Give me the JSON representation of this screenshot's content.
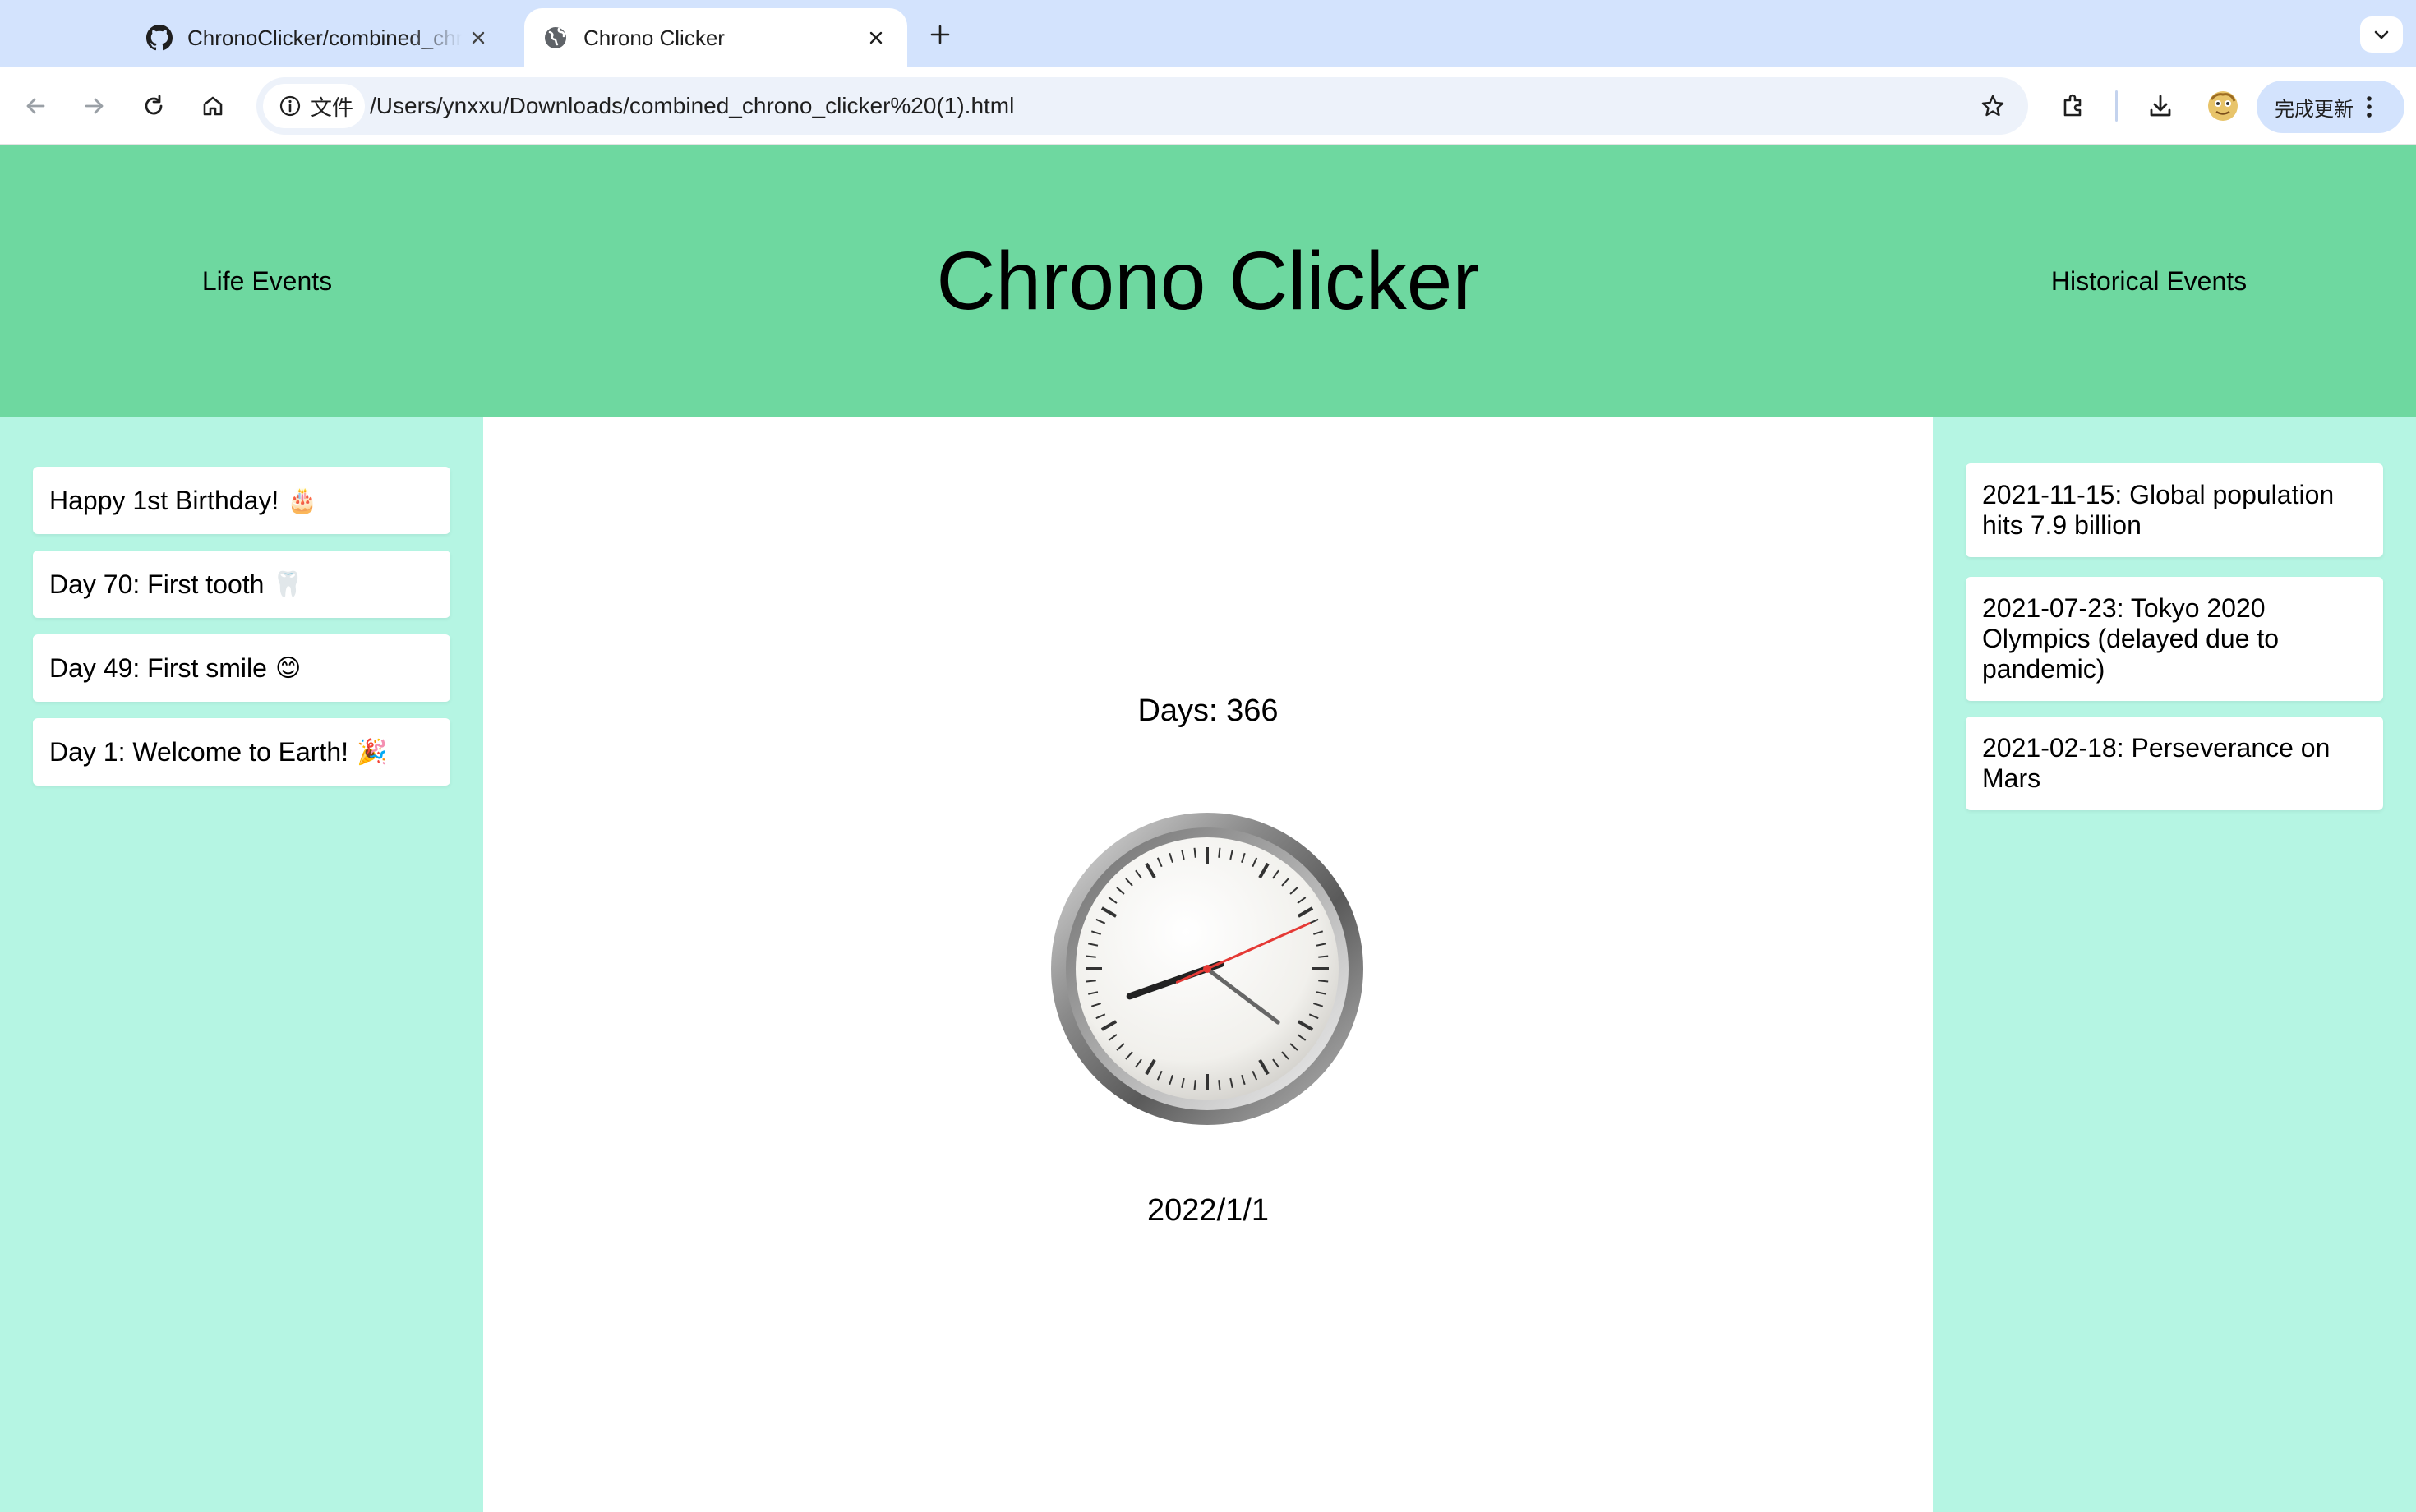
{
  "browser": {
    "tabs": [
      {
        "title": "ChronoClicker/combined_chrono_clicker.html",
        "active": false,
        "favicon": "github-icon"
      },
      {
        "title": "Chrono Clicker",
        "active": true,
        "favicon": "globe-icon"
      }
    ],
    "site_chip_label": "文件",
    "url": "/Users/ynxxu/Downloads/combined_chrono_clicker%20(1).html",
    "update_label": "完成更新"
  },
  "header": {
    "title": "Chrono Clicker",
    "nav_left": "Life Events",
    "nav_right": "Historical Events",
    "color": "#6ed8a0"
  },
  "life_events": [
    {
      "text": "Happy 1st Birthday!",
      "emoji": "🎂"
    },
    {
      "text": "Day 70: First tooth",
      "emoji": "🦷"
    },
    {
      "text": "Day 49: First smile",
      "emoji": "😊"
    },
    {
      "text": "Day 1: Welcome to Earth!",
      "emoji": "🎉"
    }
  ],
  "historical_events": [
    {
      "text": "2021-11-15: Global population hits 7.9 billion"
    },
    {
      "text": "2021-07-23: Tokyo 2020 Olympics (delayed due to pandemic)"
    },
    {
      "text": "2021-02-18: Perseverance on Mars"
    }
  ],
  "main": {
    "days_label": "Days: 366",
    "date": "2022/1/1",
    "clock": {
      "hour": 8,
      "minute": 21,
      "second": 11
    }
  },
  "colors": {
    "sidebar_bg": "#b5f5e3",
    "second_hand": "#e53935",
    "tabstrip_bg": "#d3e3fd"
  }
}
